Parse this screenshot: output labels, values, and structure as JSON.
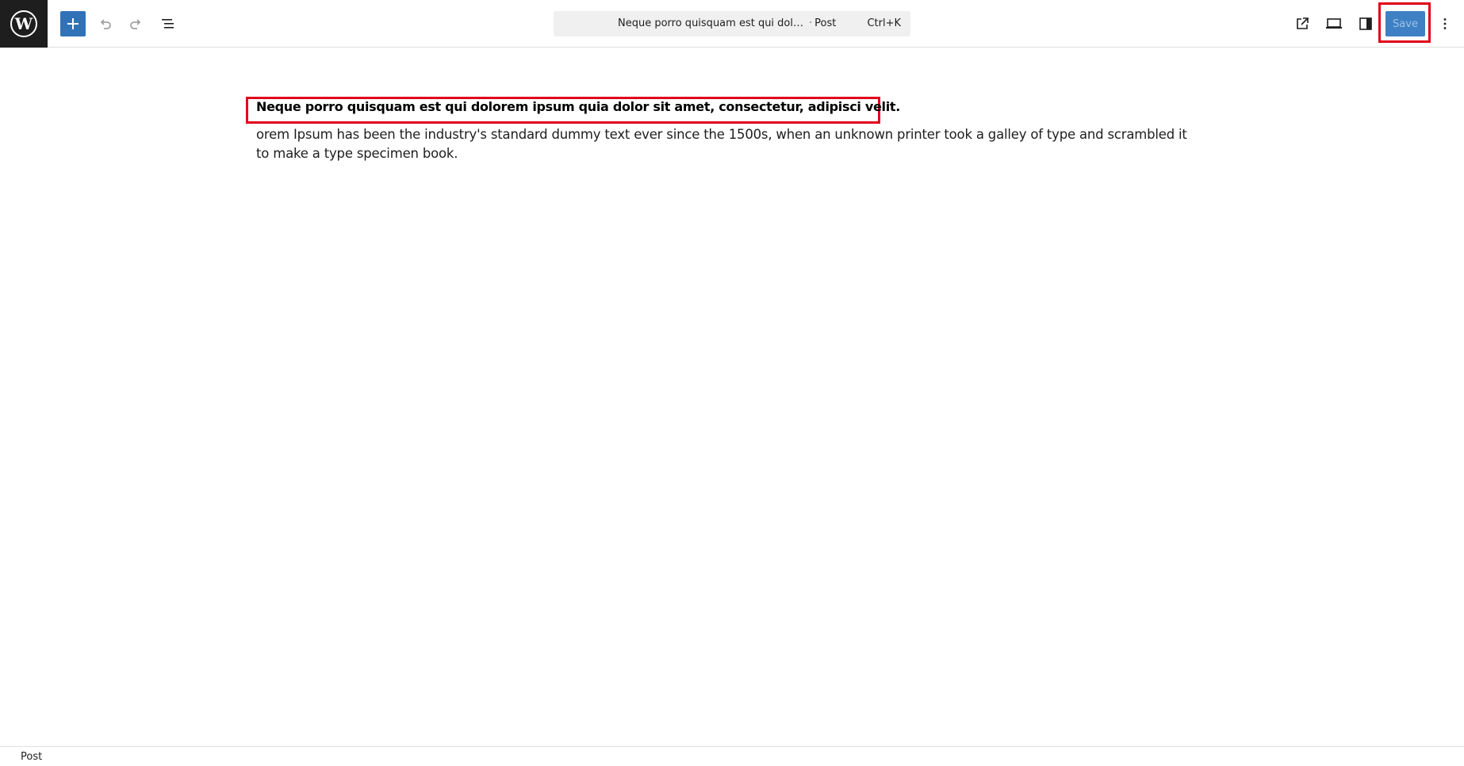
{
  "toolbar": {
    "logo_icon": "wordpress-logo-icon",
    "add_block_icon": "plus-icon",
    "undo_icon": "undo-icon",
    "redo_icon": "redo-icon",
    "document_overview_icon": "list-view-icon",
    "view_post_icon": "external-link-icon",
    "preview_icon": "desktop-preview-icon",
    "settings_icon": "sidebar-settings-icon",
    "options_icon": "more-vertical-icon",
    "save_label": "Save",
    "accent_color": "#3072b8",
    "highlight_color": "#e0001b"
  },
  "command_bar": {
    "title": "Neque porro quisquam est qui dolorem ipsum quia dolor sit amet, consectetur, adipisci velit.",
    "separator": "·",
    "post_type": "Post",
    "shortcut": "Ctrl+K"
  },
  "editor": {
    "heading": "Neque porro quisquam est qui dolorem ipsum quia dolor sit amet, consectetur, adipisci velit.",
    "paragraph": "orem Ipsum has been the industry's standard dummy text ever since the 1500s, when an unknown printer took a galley of type and scrambled it to make a type specimen book."
  },
  "footer": {
    "breadcrumb": "Post"
  }
}
